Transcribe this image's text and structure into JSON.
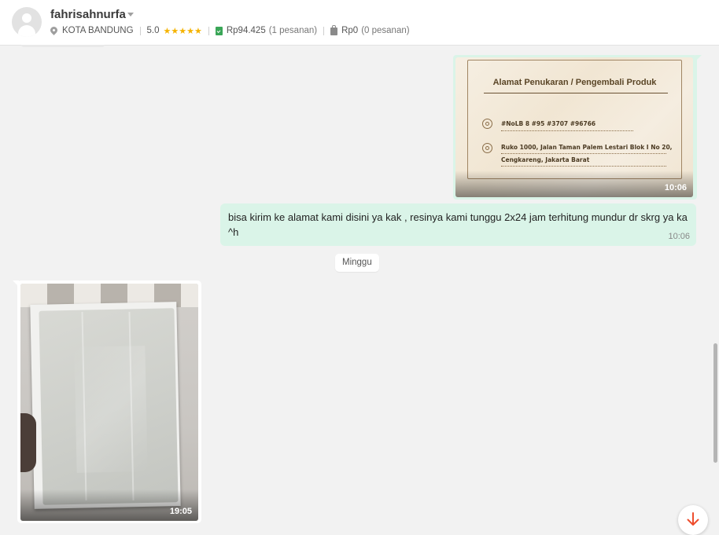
{
  "header": {
    "username": "fahrisahnurfa",
    "location": "KOTA BANDUNG",
    "rating": "5.0",
    "stars": "★★★★★",
    "paid_amount": "Rp94.425",
    "paid_orders": "(1 pesanan)",
    "unpaid_amount": "Rp0",
    "unpaid_orders": "(0 pesanan)"
  },
  "messages": {
    "outgoing_image": {
      "card_title": "Alamat Penukaran / Pengembali Produk",
      "phone_line": "#NoLB 8 #95 #3707 #96766",
      "address_line1": "Ruko 1000, Jalan Taman Palem Lestari Blok I No 20,",
      "address_line2": "Cengkareng, Jakarta Barat",
      "time": "10:06"
    },
    "outgoing_text": {
      "text": "bisa kirim ke alamat kami disini ya kak , resinya kami tunggu 2x24 jam terhitung mundur dr skrg ya ka ^h",
      "time": "10:06"
    },
    "day_separator": "Minggu",
    "incoming_image": {
      "time": "19:05"
    }
  },
  "colors": {
    "outgoing_bubble": "#daf4e8",
    "accent": "#ee4d2d",
    "star": "#f5b301"
  },
  "icons": [
    "location-pin-icon",
    "star-icon",
    "clipboard-check-icon",
    "bag-icon",
    "phone-icon",
    "location-icon",
    "arrow-down-icon",
    "chevron-down-icon"
  ]
}
